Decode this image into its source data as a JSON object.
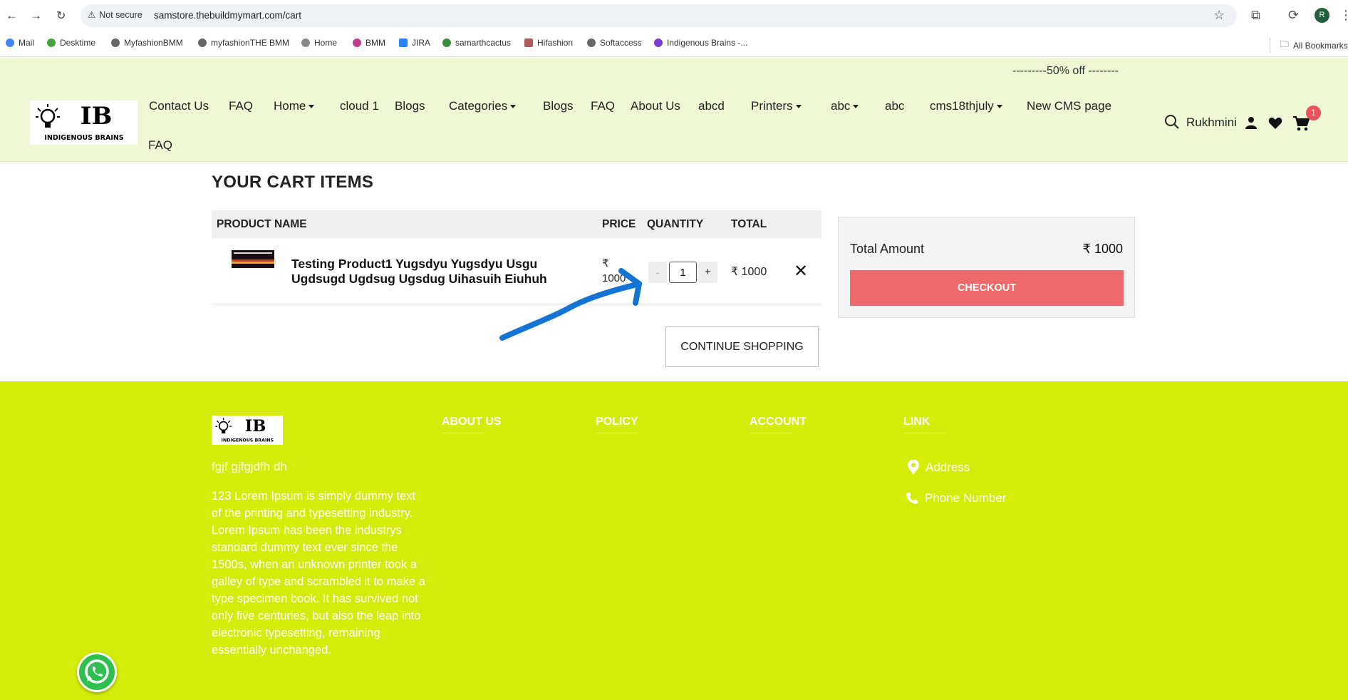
{
  "browser": {
    "security": "Not secure",
    "url": "samstore.thebuildmymart.com/cart",
    "profile_initial": "R"
  },
  "bookmarks": [
    {
      "label": "Mail",
      "icon": "google-icon"
    },
    {
      "label": "Desktime",
      "icon": "desktime-icon"
    },
    {
      "label": "MyfashionBMM",
      "icon": "globe-icon"
    },
    {
      "label": "myfashionTHE BMM",
      "icon": "globe-icon"
    },
    {
      "label": "Home",
      "icon": "globe-icon"
    },
    {
      "label": "BMM",
      "icon": "bmm-icon"
    },
    {
      "label": "JIRA",
      "icon": "jira-icon"
    },
    {
      "label": "samarthcactus",
      "icon": "cactus-icon"
    },
    {
      "label": "Hifashion",
      "icon": "hifashion-icon"
    },
    {
      "label": "Softaccess",
      "icon": "globe-icon"
    },
    {
      "label": "Indigenous Brains -...",
      "icon": "ib-icon"
    }
  ],
  "bookmarks_all": "All Bookmarks",
  "promo": "---------50% off --------",
  "logo": {
    "mark": "IB",
    "text": "INDIGENOUS BRAINS"
  },
  "nav": [
    {
      "label": "Contact Us"
    },
    {
      "label": "FAQ"
    },
    {
      "label": "Home",
      "dropdown": true
    },
    {
      "label": "cloud 1"
    },
    {
      "label": "Blogs"
    },
    {
      "label": "Categories",
      "dropdown": true
    },
    {
      "label": "Blogs"
    },
    {
      "label": "FAQ"
    },
    {
      "label": "About Us"
    },
    {
      "label": "abcd"
    },
    {
      "label": "Printers",
      "dropdown": true
    },
    {
      "label": "abc",
      "dropdown": true
    },
    {
      "label": "abc"
    },
    {
      "label": "cms18thjuly",
      "dropdown": true
    },
    {
      "label": "New CMS page"
    },
    {
      "label": "FAQ"
    }
  ],
  "header_user": "Rukhmini",
  "cart_count": "1",
  "cart": {
    "title": "YOUR CART ITEMS",
    "columns": {
      "product": "PRODUCT NAME",
      "price": "PRICE",
      "quantity": "QUANTITY",
      "total": "TOTAL"
    },
    "item": {
      "name": "Testing Product1 Yugsdyu Yugsdyu Usgu Ugdsugd Ugdsug Ugsdug Uihasuih Eiuhuh",
      "price": "₹ 1000",
      "quantity": "1",
      "decrement": "-",
      "increment": "+",
      "total": "₹ 1000",
      "remove": "✕"
    },
    "continue_label": "CONTINUE SHOPPING"
  },
  "summary": {
    "label": "Total Amount",
    "value": "₹ 1000",
    "checkout_label": "CHECKOUT"
  },
  "footer": {
    "tagline": "fgjf gjfgjdfh dh",
    "description": "123 Lorem Ipsum is simply dummy text of the printing and typesetting industry. Lorem Ipsum has been the industrys standard dummy text ever since the 1500s, when an unknown printer took a galley of type and scrambled it to make a type specimen book. It has survived not only five centuries, but also the leap into electronic typesetting, remaining essentially unchanged.",
    "headings": [
      "ABOUT US",
      "POLICY",
      "ACCOUNT",
      "LINK"
    ],
    "address": "Address",
    "phone": "Phone Number"
  },
  "colors": {
    "header_bg": "#eff8d4",
    "footer_bg": "#d4ec07",
    "checkout_bg": "#ee6a6a",
    "badge": "#e7525d",
    "annotation_arrow": "#1474d4"
  }
}
